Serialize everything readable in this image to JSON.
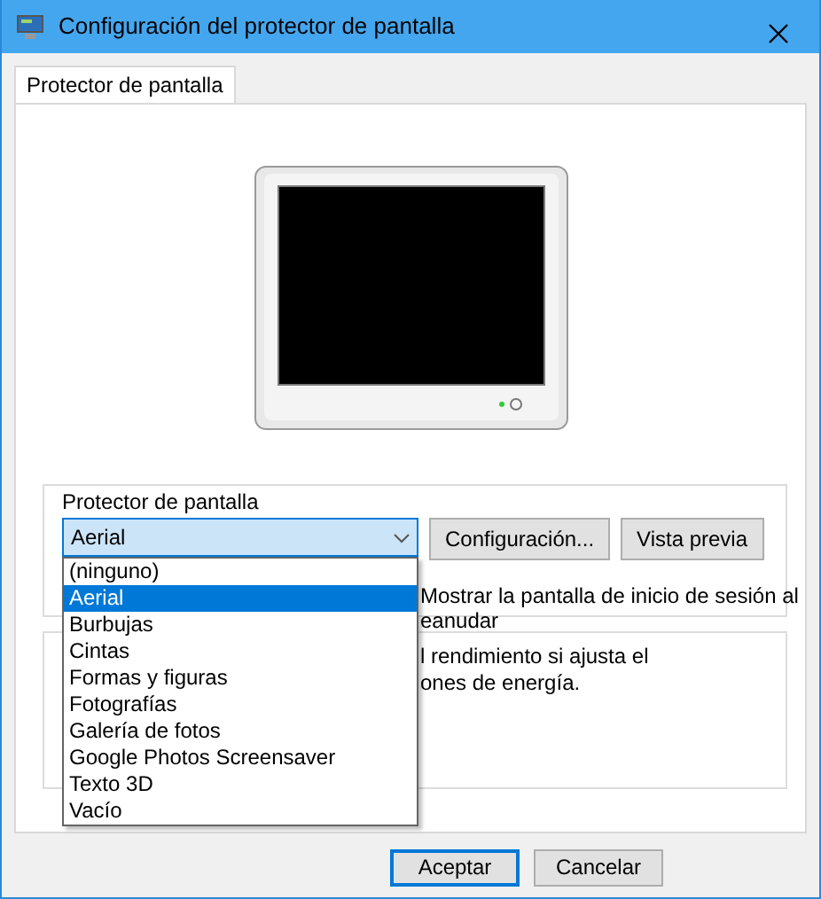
{
  "window": {
    "title": "Configuración del protector de pantalla"
  },
  "tabs": [
    {
      "label": "Protector de pantalla",
      "selected": true
    }
  ],
  "screensaver_group": {
    "title": "Protector de pantalla",
    "dropdown": {
      "value": "Aerial",
      "expanded": true,
      "options": [
        {
          "label": "(ninguno)",
          "selected": false
        },
        {
          "label": "Aerial",
          "selected": true
        },
        {
          "label": "Burbujas",
          "selected": false
        },
        {
          "label": "Cintas",
          "selected": false
        },
        {
          "label": "Formas y figuras",
          "selected": false
        },
        {
          "label": "Fotografías",
          "selected": false
        },
        {
          "label": "Galería de fotos",
          "selected": false
        },
        {
          "label": "Google Photos Screensaver",
          "selected": false
        },
        {
          "label": "Texto 3D",
          "selected": false
        },
        {
          "label": "Vacío",
          "selected": false
        }
      ]
    },
    "buttons": [
      "Configuración...",
      "Vista previa"
    ],
    "partly_hidden_texts": [
      "Mostrar la pantalla de inicio de sesión al",
      "eanudar"
    ]
  },
  "power_group": {
    "partly_hidden_texts": [
      "l rendimiento si ajusta el",
      "ones de energía."
    ]
  },
  "buttons": [
    {
      "label": "Aceptar",
      "default": true
    },
    {
      "label": "Cancelar",
      "default": false
    }
  ]
}
